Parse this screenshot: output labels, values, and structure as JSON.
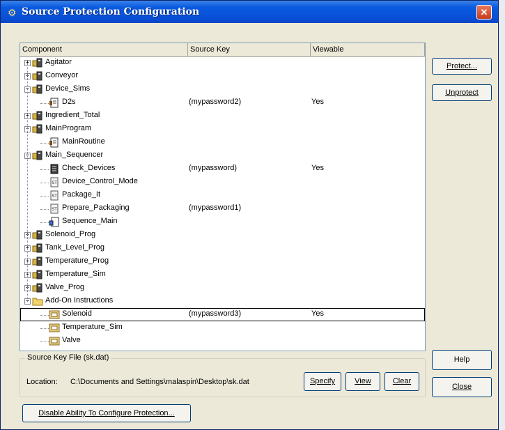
{
  "window": {
    "title": "Source Protection Configuration",
    "close_glyph": "✕"
  },
  "list": {
    "columns": [
      "Component",
      "Source Key",
      "Viewable"
    ],
    "rows": [
      {
        "name": "Agitator",
        "level": 0,
        "expander": "+",
        "icon": "program-folder-icon",
        "key": "",
        "viewable": ""
      },
      {
        "name": "Conveyor",
        "level": 0,
        "expander": "+",
        "icon": "program-folder-icon",
        "key": "",
        "viewable": ""
      },
      {
        "name": "Device_Sims",
        "level": 0,
        "expander": "−",
        "icon": "program-folder-icon",
        "key": "",
        "viewable": ""
      },
      {
        "name": "D2s",
        "level": 1,
        "expander": "",
        "icon": "routine-icon",
        "key": "(mypassword2)",
        "viewable": "Yes"
      },
      {
        "name": "Ingredient_Total",
        "level": 0,
        "expander": "+",
        "icon": "program-folder-icon",
        "key": "",
        "viewable": ""
      },
      {
        "name": "MainProgram",
        "level": 0,
        "expander": "−",
        "icon": "program-folder-icon",
        "key": "",
        "viewable": ""
      },
      {
        "name": "MainRoutine",
        "level": 1,
        "expander": "",
        "icon": "routine-icon",
        "key": "",
        "viewable": ""
      },
      {
        "name": "Main_Sequencer",
        "level": 0,
        "expander": "−",
        "icon": "program-folder-icon",
        "key": "",
        "viewable": ""
      },
      {
        "name": "Check_Devices",
        "level": 1,
        "expander": "",
        "icon": "ladder-routine-icon",
        "key": "(mypassword)",
        "viewable": "Yes"
      },
      {
        "name": "Device_Control_Mode",
        "level": 1,
        "expander": "",
        "icon": "text-routine-icon",
        "key": "",
        "viewable": ""
      },
      {
        "name": "Package_It",
        "level": 1,
        "expander": "",
        "icon": "text-routine-icon",
        "key": "",
        "viewable": ""
      },
      {
        "name": "Prepare_Packaging",
        "level": 1,
        "expander": "",
        "icon": "text-routine-icon",
        "key": "(mypassword1)",
        "viewable": ""
      },
      {
        "name": "Sequence_Main",
        "level": 1,
        "expander": "",
        "icon": "sfc-routine-icon",
        "key": "",
        "viewable": ""
      },
      {
        "name": "Solenoid_Prog",
        "level": 0,
        "expander": "+",
        "icon": "program-folder-icon",
        "key": "",
        "viewable": ""
      },
      {
        "name": "Tank_Level_Prog",
        "level": 0,
        "expander": "+",
        "icon": "program-folder-icon",
        "key": "",
        "viewable": ""
      },
      {
        "name": "Temperature_Prog",
        "level": 0,
        "expander": "+",
        "icon": "program-folder-icon",
        "key": "",
        "viewable": ""
      },
      {
        "name": "Temperature_Sim",
        "level": 0,
        "expander": "+",
        "icon": "program-folder-icon",
        "key": "",
        "viewable": ""
      },
      {
        "name": "Valve_Prog",
        "level": 0,
        "expander": "+",
        "icon": "program-folder-icon",
        "key": "",
        "viewable": ""
      },
      {
        "name": "Add-On Instructions",
        "level": 0,
        "expander": "−",
        "icon": "folder-icon",
        "key": "",
        "viewable": ""
      },
      {
        "name": "Solenoid",
        "level": 1,
        "expander": "",
        "icon": "aoi-icon",
        "key": "(mypassword3)",
        "viewable": "Yes",
        "selected": true
      },
      {
        "name": "Temperature_Sim",
        "level": 1,
        "expander": "",
        "icon": "aoi-icon",
        "key": "",
        "viewable": ""
      },
      {
        "name": "Valve",
        "level": 1,
        "expander": "",
        "icon": "aoi-icon",
        "key": "",
        "viewable": ""
      }
    ]
  },
  "buttons": {
    "protect": "Protect...",
    "unprotect": "Unprotect",
    "help": "Help",
    "close": "Close",
    "specify": "Specify",
    "view": "View",
    "clear": "Clear",
    "disable": "Disable Ability To Configure Protection..."
  },
  "source_key_file": {
    "group_title": "Source Key File (sk.dat)",
    "location_label": "Location:",
    "location_value": "C:\\Documents and Settings\\malaspin\\Desktop\\sk.dat"
  },
  "colors": {
    "titlebar": "#0a5ae0",
    "dialog_bg": "#ece9d8",
    "close_button": "#c83c1c"
  }
}
